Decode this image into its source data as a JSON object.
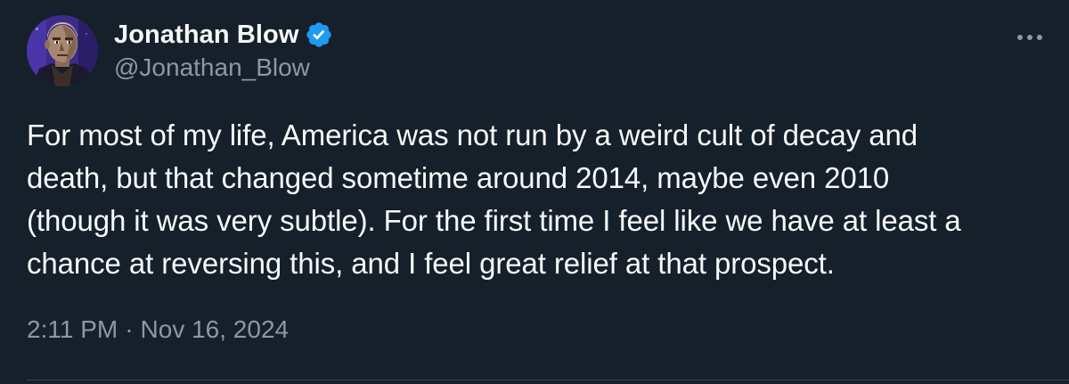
{
  "author": {
    "display_name": "Jonathan Blow",
    "handle": "@Jonathan_Blow",
    "verified": true,
    "avatar_icon": "pixel-art-portrait-avatar"
  },
  "tweet": {
    "lines": [
      "For most of my life, America was not run by a weird cult of decay and",
      "death, but that changed sometime around 2014, maybe even 2010",
      "(though it was very subtle). For the first time I feel like we have at least a",
      "chance at reversing this, and I feel great relief at that prospect."
    ],
    "time": "2:11 PM",
    "separator": "·",
    "date": "Nov 16, 2024"
  },
  "actions": {
    "more_icon": "more-horizontal-icon"
  },
  "colors": {
    "background": "#15202b",
    "text_primary": "#f7f9f9",
    "text_secondary": "#8b98a5",
    "verified_blue": "#1d9bf0",
    "divider": "#38444d"
  }
}
